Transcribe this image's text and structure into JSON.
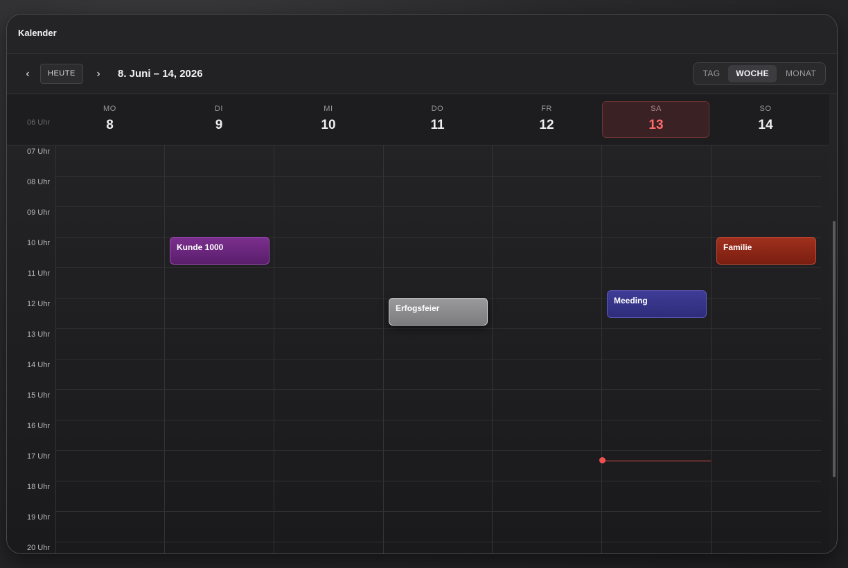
{
  "window": {
    "title": "Kalender"
  },
  "toolbar": {
    "prev_icon": "‹",
    "next_icon": "›",
    "today_label": "HEUTE",
    "range_label": "8. Juni – 14, 2026",
    "views": [
      {
        "label": "TAG",
        "active": false
      },
      {
        "label": "WOCHE",
        "active": true
      },
      {
        "label": "MONAT",
        "active": false
      }
    ]
  },
  "days": [
    {
      "dow": "MO",
      "num": "8"
    },
    {
      "dow": "DI",
      "num": "9"
    },
    {
      "dow": "MI",
      "num": "10"
    },
    {
      "dow": "DO",
      "num": "11"
    },
    {
      "dow": "FR",
      "num": "12"
    },
    {
      "dow": "SA",
      "num": "13",
      "today": true
    },
    {
      "dow": "SO",
      "num": "14"
    }
  ],
  "first_hour_label": "06 Uhr",
  "hours": [
    "07 Uhr",
    "08 Uhr",
    "09 Uhr",
    "10 Uhr",
    "11 Uhr",
    "12 Uhr",
    "13 Uhr",
    "14 Uhr",
    "15 Uhr",
    "16 Uhr",
    "17 Uhr",
    "18 Uhr",
    "19 Uhr",
    "20 Uhr"
  ],
  "events": [
    {
      "title": "Kunde 1000",
      "color": "#7a2f8e"
    },
    {
      "title": "Erfogsfeier",
      "color": "#9a9a9c"
    },
    {
      "title": "Meeding",
      "color": "#3e3c96"
    },
    {
      "title": "Familie",
      "color": "#a0301e"
    }
  ],
  "colors": {
    "today_accent": "#ff6b6b",
    "now_indicator": "#e04a4a"
  }
}
